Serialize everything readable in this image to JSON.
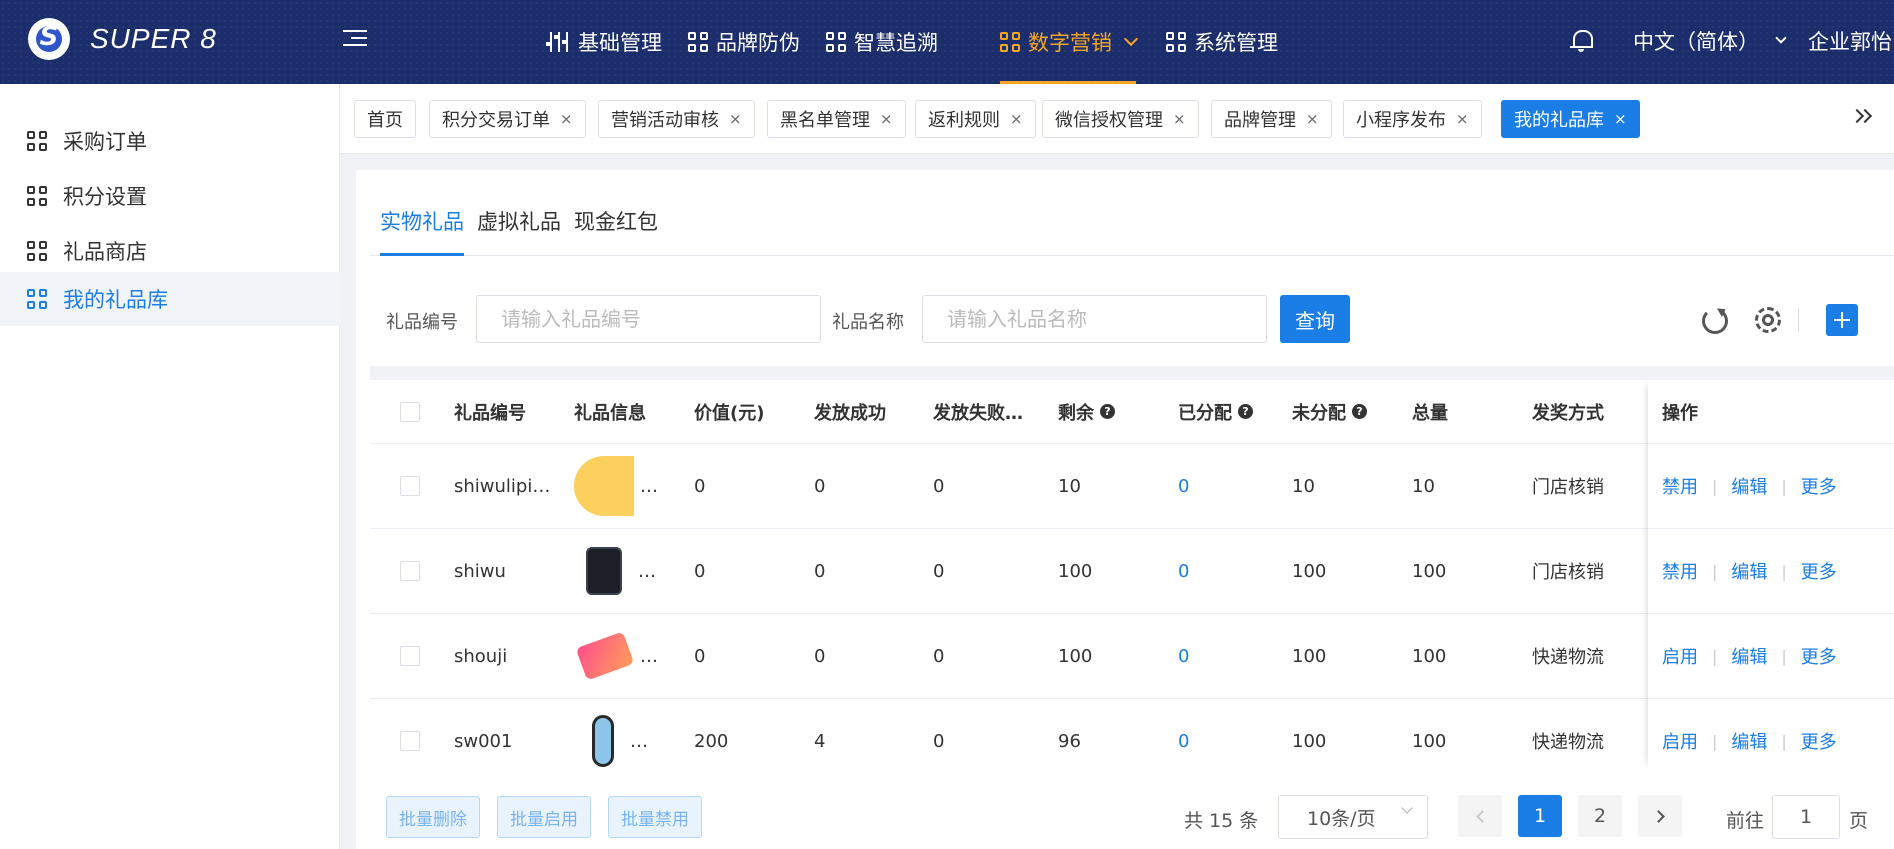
{
  "header": {
    "logo_text": "SUPER 8",
    "nav": [
      {
        "label": "基础管理",
        "icon": "sliders-icon"
      },
      {
        "label": "品牌防伪",
        "icon": "grid-icon"
      },
      {
        "label": "智慧追溯",
        "icon": "grid-icon"
      },
      {
        "label": "数字营销",
        "icon": "grid-icon",
        "active": true
      },
      {
        "label": "系统管理",
        "icon": "grid-icon"
      }
    ],
    "language": "中文（简体）",
    "user": "企业郭怡"
  },
  "sidebar": {
    "items": [
      {
        "label": "采购订单"
      },
      {
        "label": "积分设置"
      },
      {
        "label": "礼品商店"
      },
      {
        "label": "我的礼品库",
        "active": true
      }
    ]
  },
  "tags": [
    {
      "label": "首页",
      "closable": false
    },
    {
      "label": "积分交易订单",
      "closable": true
    },
    {
      "label": "营销活动审核",
      "closable": true
    },
    {
      "label": "黑名单管理",
      "closable": true
    },
    {
      "label": "返利规则",
      "closable": true
    },
    {
      "label": "微信授权管理",
      "closable": true
    },
    {
      "label": "品牌管理",
      "closable": true
    },
    {
      "label": "小程序发布",
      "closable": true
    },
    {
      "label": "我的礼品库",
      "closable": true,
      "active": true
    }
  ],
  "close_glyph": "×",
  "subtabs": [
    "实物礼品",
    "虚拟礼品",
    "现金红包"
  ],
  "filters": {
    "code_label": "礼品编号",
    "code_placeholder": "请输入礼品编号",
    "name_label": "礼品名称",
    "name_placeholder": "请输入礼品名称",
    "query_label": "查询"
  },
  "table": {
    "headers": [
      "礼品编号",
      "礼品信息",
      "价值(元)",
      "发放成功",
      "发放失败…",
      "剩余",
      "已分配",
      "未分配",
      "总量",
      "发奖方式",
      "操作"
    ],
    "help_glyph": "?",
    "rows": [
      {
        "code": "shiwulipi…",
        "info": "…",
        "value": "0",
        "success": "0",
        "fail": "0",
        "remaining": "10",
        "allocated": "0",
        "unallocated": "10",
        "total": "10",
        "method": "门店核销",
        "toggle": "禁用",
        "thumb": "yellow-card"
      },
      {
        "code": "shiwu",
        "info": "…",
        "value": "0",
        "success": "0",
        "fail": "0",
        "remaining": "100",
        "allocated": "0",
        "unallocated": "100",
        "total": "100",
        "method": "门店核销",
        "toggle": "禁用",
        "thumb": "phone"
      },
      {
        "code": "shouji",
        "info": "…",
        "value": "0",
        "success": "0",
        "fail": "0",
        "remaining": "100",
        "allocated": "0",
        "unallocated": "100",
        "total": "100",
        "method": "快递物流",
        "toggle": "启用",
        "thumb": "phone-13"
      },
      {
        "code": "sw001",
        "info": "…",
        "value": "200",
        "success": "4",
        "fail": "0",
        "remaining": "96",
        "allocated": "0",
        "unallocated": "100",
        "total": "100",
        "method": "快递物流",
        "toggle": "启用",
        "thumb": "smart-band"
      }
    ],
    "edit_label": "编辑",
    "more_label": "更多",
    "op_sep": "|"
  },
  "footer": {
    "batch_delete": "批量删除",
    "batch_enable": "批量启用",
    "batch_disable": "批量禁用",
    "total_text": "共 15 条",
    "page_size": "10条/页",
    "pages": [
      "1",
      "2"
    ],
    "current_page": "1",
    "goto_label": "前往",
    "goto_value": "1",
    "page_suffix": "页"
  },
  "colors": {
    "header_bg": "#1b2d6b",
    "accent": "#1a7ee6",
    "nav_active": "#f5a623"
  }
}
